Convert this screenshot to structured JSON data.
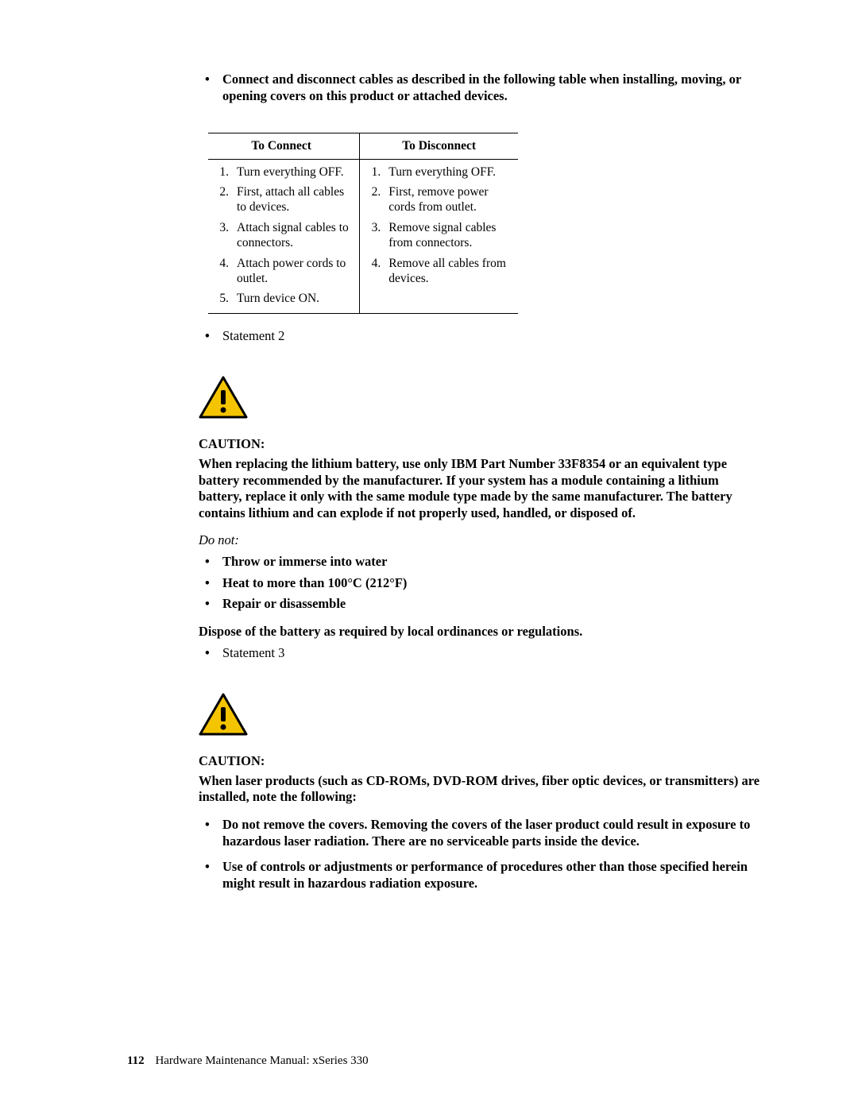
{
  "intro_bullet": "Connect and disconnect cables as described in the following table when installing, moving, or opening covers on this product or attached devices.",
  "table": {
    "headers": {
      "connect": "To Connect",
      "disconnect": "To Disconnect"
    },
    "rows": [
      {
        "cnum": "1.",
        "ctext": "Turn everything OFF.",
        "dnum": "1.",
        "dtext": "Turn everything OFF."
      },
      {
        "cnum": "2.",
        "ctext": "First, attach all cables to devices.",
        "dnum": "2.",
        "dtext": "First, remove power cords from outlet."
      },
      {
        "cnum": "3.",
        "ctext": "Attach signal cables to connectors.",
        "dnum": "3.",
        "dtext": "Remove signal cables from connectors."
      },
      {
        "cnum": "4.",
        "ctext": "Attach power cords to outlet.",
        "dnum": "4.",
        "dtext": "Remove all cables from devices."
      },
      {
        "cnum": "5.",
        "ctext": "Turn device ON.",
        "dnum": "",
        "dtext": ""
      }
    ]
  },
  "statement2_label": "Statement 2",
  "caution_label": "CAUTION:",
  "caution2_text": "When replacing the lithium battery, use only IBM Part Number 33F8354 or an equivalent type battery recommended by the manufacturer.  If your system has a module containing a lithium battery, replace it only with the same module type made by the same manufacturer. The battery contains lithium and can explode if not properly used, handled, or disposed of.",
  "do_not_label": "Do not:",
  "do_not_items": [
    "Throw or immerse into water",
    "Heat to more than 100°C  (212°F)",
    "Repair or disassemble"
  ],
  "dispose_text": "Dispose of the battery as required by local ordinances or regulations.",
  "statement3_label": "Statement 3",
  "caution3_text": "When laser products (such as CD-ROMs, DVD-ROM drives, fiber optic devices, or transmitters) are installed, note the following:",
  "caution3_items": [
    "Do not remove the covers.  Removing the covers of the laser product could result in exposure to hazardous laser radiation.  There are no serviceable parts inside the device.",
    "Use of controls or adjustments or performance of procedures other than those specified herein might result in hazardous radiation exposure."
  ],
  "footer": {
    "page": "112",
    "title": "Hardware Maintenance Manual: xSeries 330"
  }
}
